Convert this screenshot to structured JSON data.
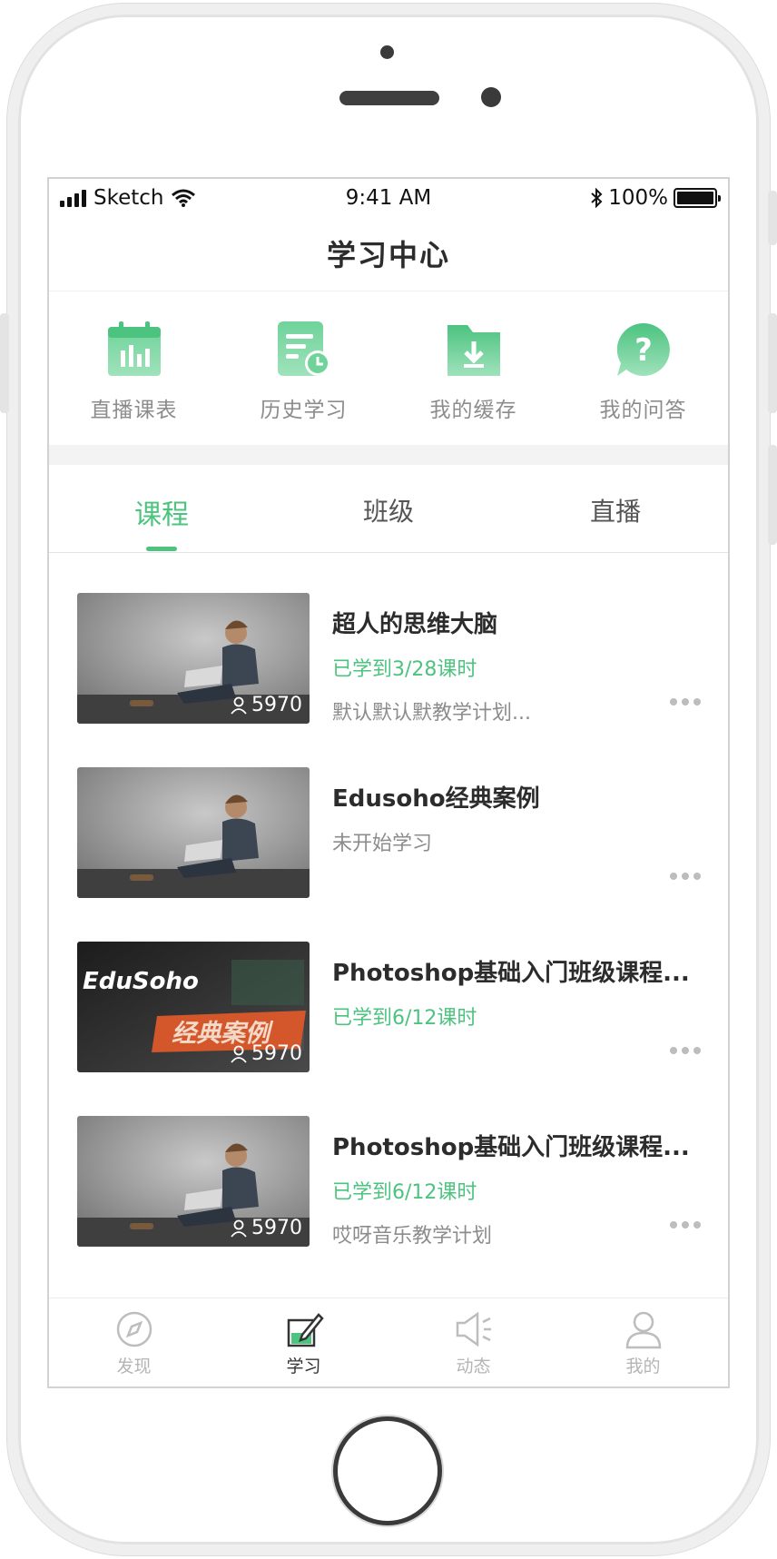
{
  "status_bar": {
    "carrier": "Sketch",
    "time": "9:41 AM",
    "battery": "100%"
  },
  "header": {
    "title": "学习中心"
  },
  "quick_actions": [
    {
      "label": "直播课表",
      "icon": "calendar-chart-icon"
    },
    {
      "label": "历史学习",
      "icon": "history-doc-icon"
    },
    {
      "label": "我的缓存",
      "icon": "download-folder-icon"
    },
    {
      "label": "我的问答",
      "icon": "question-bubble-icon"
    }
  ],
  "tabs": [
    {
      "label": "课程",
      "active": true
    },
    {
      "label": "班级",
      "active": false
    },
    {
      "label": "直播",
      "active": false
    }
  ],
  "courses": [
    {
      "title": "超人的思维大脑",
      "progress": "已学到3/28课时",
      "desc": "默认默认默教学计划...",
      "students": "5970",
      "thumb": "man-laptop"
    },
    {
      "title": "Edusoho经典案例",
      "progress": "未开始学习",
      "desc": "",
      "students": "",
      "thumb": "man-laptop"
    },
    {
      "title": "Photoshop基础入门班级课程...",
      "progress": "已学到6/12课时",
      "desc": "",
      "students": "5970",
      "thumb": "edusoho-banner",
      "banner_brand": "EduSoho",
      "banner_text": "经典案例"
    },
    {
      "title": "Photoshop基础入门班级课程...",
      "progress": "已学到6/12课时",
      "desc": "哎呀音乐教学计划",
      "students": "5970",
      "thumb": "man-laptop"
    }
  ],
  "tabbar": [
    {
      "label": "发现",
      "icon": "compass-icon",
      "active": false
    },
    {
      "label": "学习",
      "icon": "study-edit-icon",
      "active": true
    },
    {
      "label": "动态",
      "icon": "speaker-icon",
      "active": false
    },
    {
      "label": "我的",
      "icon": "user-icon",
      "active": false
    }
  ],
  "colors": {
    "accent": "#4cc37f",
    "text": "#2c2c2c",
    "muted": "#8c8c8c"
  }
}
